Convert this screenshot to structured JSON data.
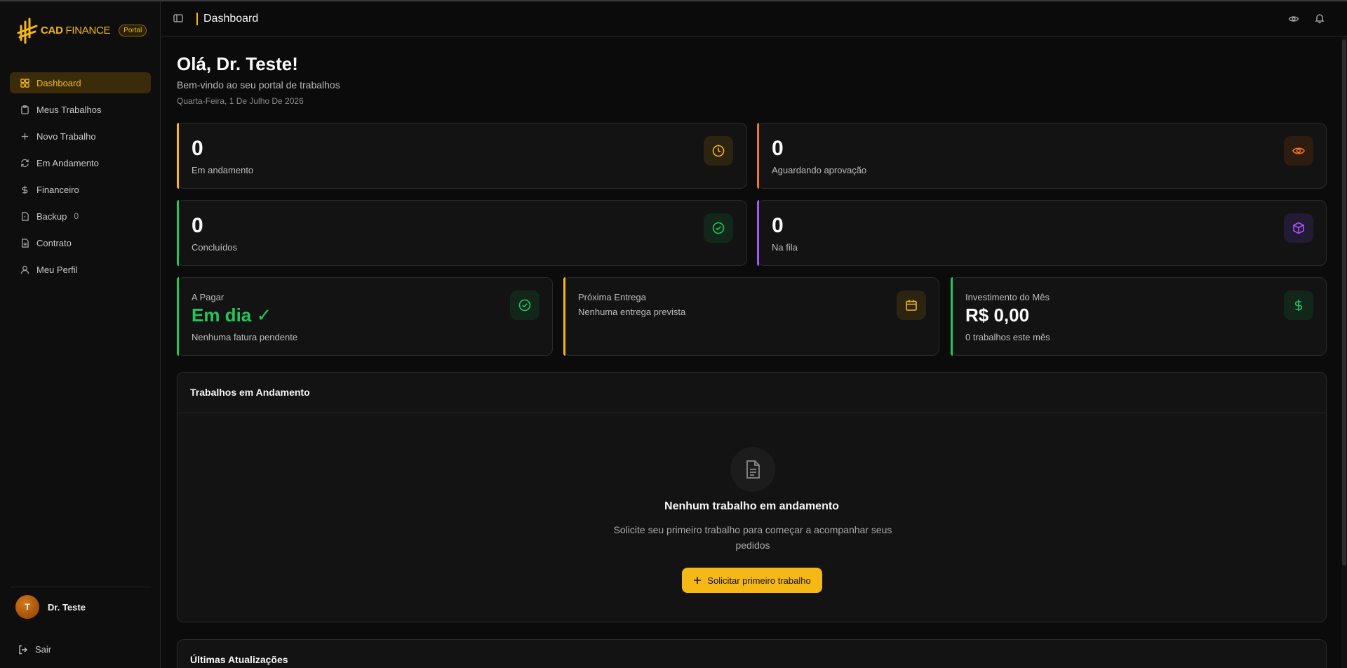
{
  "brand": {
    "name_bold": "CAD",
    "name_thin": "FINANCE",
    "badge": "Portal",
    "accent": "#f5b814"
  },
  "sidebar": {
    "items": [
      {
        "label": "Dashboard",
        "icon": "grid-icon",
        "active": true
      },
      {
        "label": "Meus Trabalhos",
        "icon": "clipboard-icon"
      },
      {
        "label": "Novo Trabalho",
        "icon": "plus-icon"
      },
      {
        "label": "Em Andamento",
        "icon": "refresh-icon"
      },
      {
        "label": "Financeiro",
        "icon": "dollar-icon"
      },
      {
        "label": "Backup",
        "icon": "file-icon",
        "count": "0"
      },
      {
        "label": "Contrato",
        "icon": "document-icon"
      },
      {
        "label": "Meu Perfil",
        "icon": "user-icon"
      }
    ],
    "user": {
      "initial": "T",
      "name": "Dr. Teste"
    },
    "logout": "Sair"
  },
  "header": {
    "title": "Dashboard"
  },
  "main": {
    "greeting": "Olá, Dr. Teste!",
    "subtitle": "Bem-vindo ao seu portal de trabalhos",
    "date": "Quarta-Feira, 1 De Julho De 2026",
    "stats": [
      {
        "value": "0",
        "label": "Em andamento",
        "color": "#f5b814",
        "icon": "clock-icon"
      },
      {
        "value": "0",
        "label": "Aguardando aprovação",
        "color": "#f07a1a",
        "icon": "eye-icon"
      },
      {
        "value": "0",
        "label": "Concluídos",
        "color": "#22c55e",
        "icon": "check-circle-icon"
      },
      {
        "value": "0",
        "label": "Na fila",
        "color": "#a855f7",
        "icon": "package-icon"
      }
    ],
    "finance": {
      "pay": {
        "label": "A Pagar",
        "value": "Em dia ✓",
        "sub": "Nenhuma fatura pendente",
        "color": "#22c55e"
      },
      "delivery": {
        "label": "Próxima Entrega",
        "sub": "Nenhuma entrega prevista",
        "color": "#f5b814"
      },
      "invest": {
        "label": "Investimento do Mês",
        "value": "R$ 0,00",
        "sub": "0 trabalhos este mês",
        "color": "#22c55e"
      }
    },
    "in_progress": {
      "title": "Trabalhos em Andamento",
      "empty_title": "Nenhum trabalho em andamento",
      "empty_sub": "Solicite seu primeiro trabalho para começar a acompanhar seus pedidos",
      "button": "Solicitar primeiro trabalho"
    },
    "updates": {
      "title": "Últimas Atualizações"
    }
  }
}
